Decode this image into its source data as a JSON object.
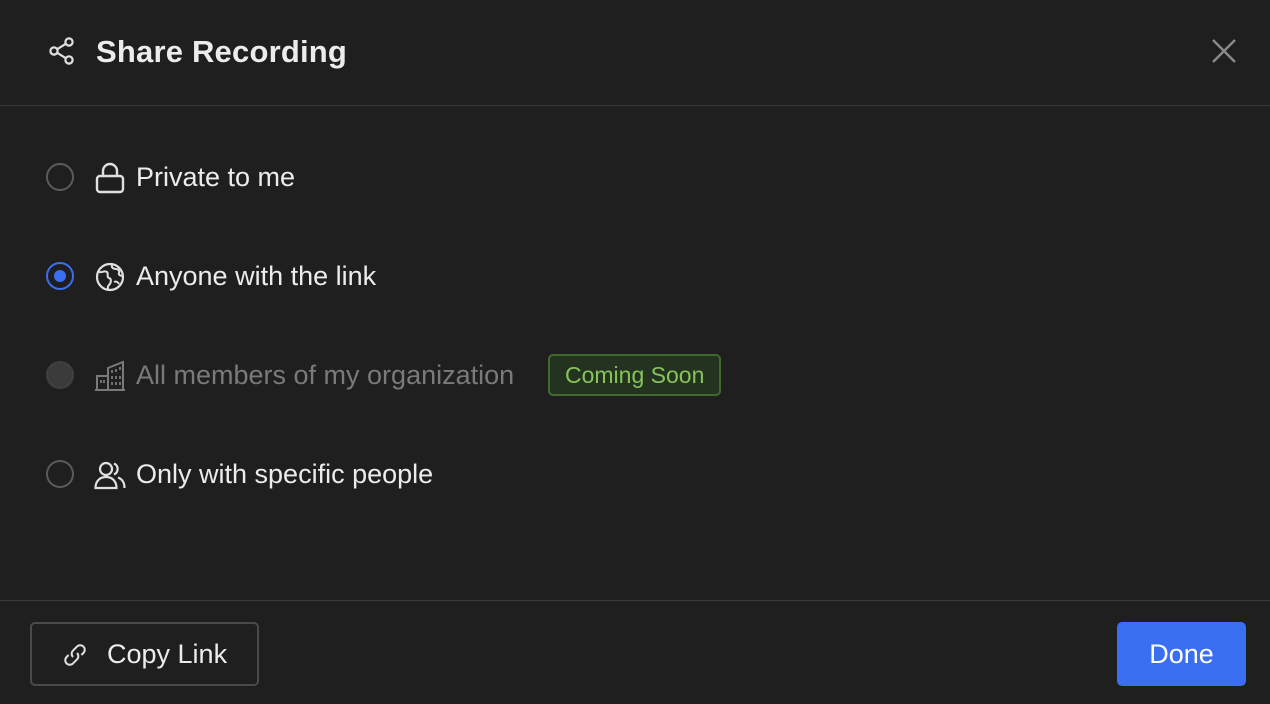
{
  "dialog": {
    "title": "Share Recording",
    "title_icon": "share-icon",
    "close_icon": "close-icon"
  },
  "options": [
    {
      "label": "Private to me",
      "icon": "lock-icon",
      "selected": false,
      "disabled": false
    },
    {
      "label": "Anyone with the link",
      "icon": "globe-icon",
      "selected": true,
      "disabled": false
    },
    {
      "label": "All members of my organization",
      "icon": "building-icon",
      "selected": false,
      "disabled": true,
      "badge": "Coming Soon"
    },
    {
      "label": "Only with specific people",
      "icon": "people-icon",
      "selected": false,
      "disabled": false
    }
  ],
  "footer": {
    "copy_label": "Copy Link",
    "copy_icon": "link-icon",
    "done_label": "Done"
  },
  "colors": {
    "accent": "#3a6ff2",
    "background": "#1f1f1f",
    "badge_text": "#86c45a",
    "badge_border": "#3f6a2c"
  }
}
